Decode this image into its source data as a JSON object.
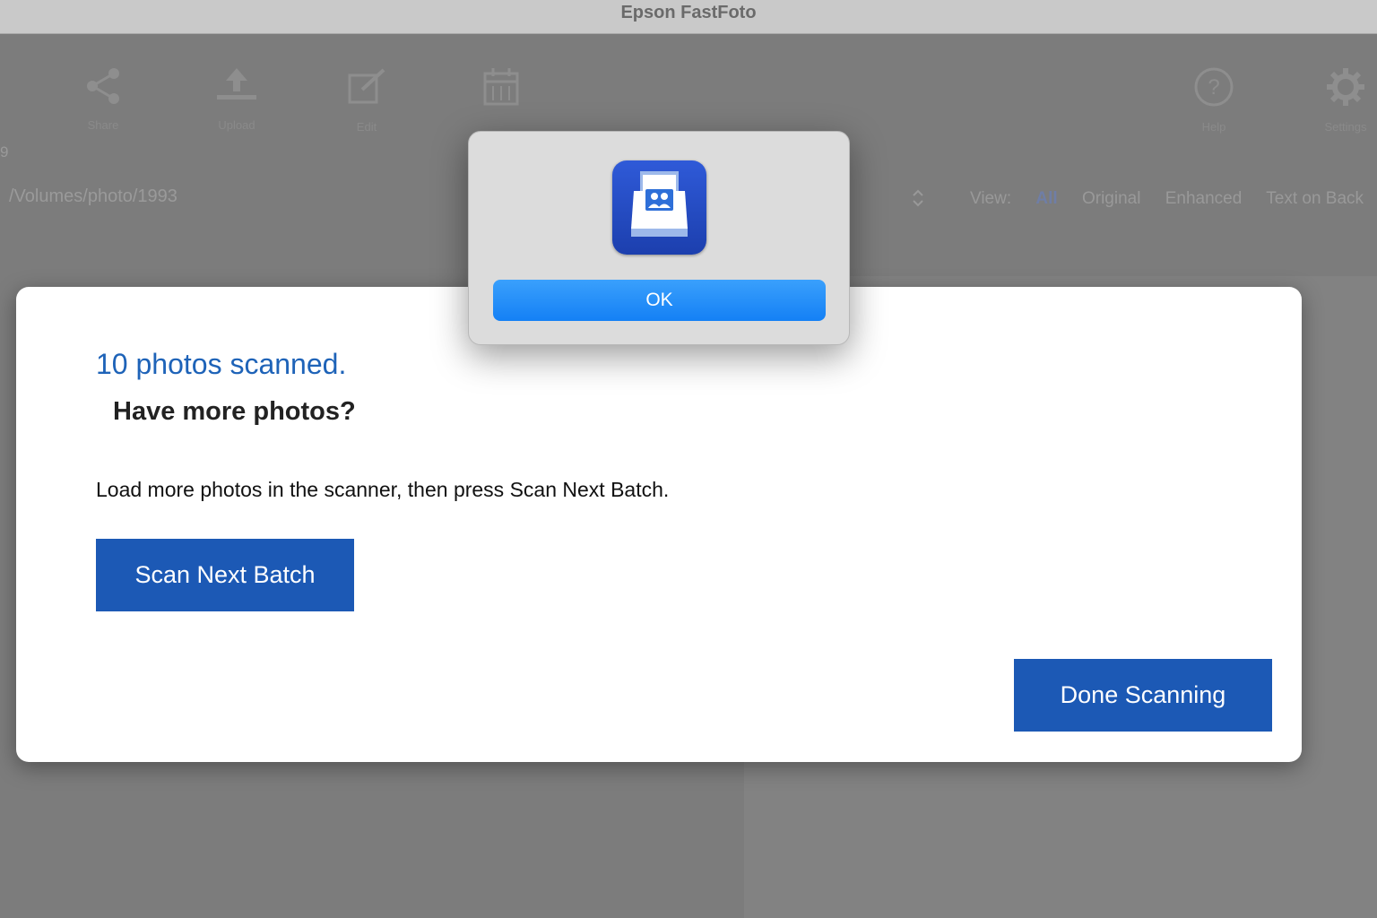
{
  "window": {
    "title": "Epson FastFoto"
  },
  "toolbar": {
    "items": [
      {
        "icon": "share-icon",
        "label": "Share"
      },
      {
        "icon": "upload-icon",
        "label": "Upload"
      },
      {
        "icon": "edit-icon",
        "label": "Edit"
      },
      {
        "icon": "calendar-icon",
        "label": ""
      },
      {
        "icon": "help-icon",
        "label": "Help"
      },
      {
        "icon": "gear-icon",
        "label": "Settings"
      }
    ]
  },
  "background": {
    "edge_number": "9",
    "folder_path": "/Volumes/photo/1993",
    "view": {
      "label": "View:",
      "options": [
        "All",
        "Original",
        "Enhanced",
        "Text on Back"
      ],
      "selected": "All"
    }
  },
  "dialog": {
    "scanned_text": "10 photos scanned.",
    "question": "Have more photos?",
    "instruction": "Load more photos in the scanner, then press Scan Next Batch.",
    "scan_next_label": "Scan Next Batch",
    "done_label": "Done Scanning"
  },
  "alert": {
    "icon": "fastfoto-app-icon",
    "ok_label": "OK"
  },
  "colors": {
    "accent_blue": "#1c59b5",
    "link_blue": "#1e63b8",
    "ok_blue": "#1480f5"
  }
}
